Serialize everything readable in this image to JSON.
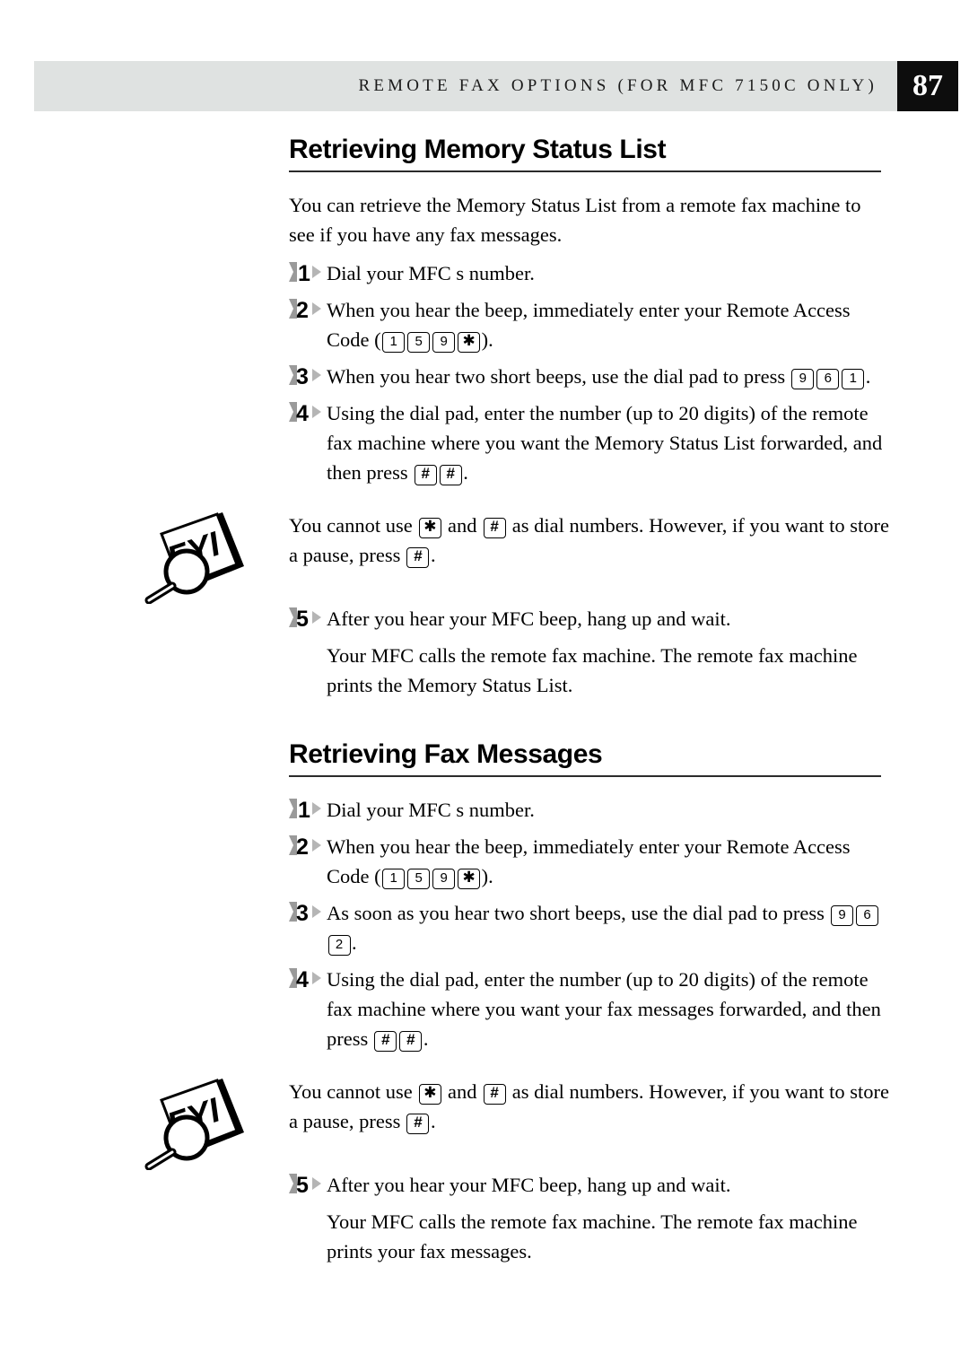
{
  "header": {
    "running_title": "REMOTE FAX OPTIONS (FOR MFC 7150C ONLY)",
    "page_number": "87",
    "band_color": "#dfe2e1",
    "page_number_bg": "#0d0d0d"
  },
  "sections": [
    {
      "heading": "Retrieving Memory Status List",
      "intro": "You can retrieve the Memory Status List from a remote fax machine to see if you have any fax messages.",
      "steps": [
        {
          "number": "1",
          "text": "Dial your MFC s number."
        },
        {
          "number": "2",
          "text_before": "When you hear the beep, immediately enter your Remote Access Code (",
          "keys": [
            "1",
            "5",
            "9",
            "✱"
          ],
          "text_after": ")."
        },
        {
          "number": "3",
          "text_before": "When you hear two short beeps, use the dial pad to press ",
          "keys": [
            "9",
            "6",
            "1"
          ],
          "text_after": "."
        },
        {
          "number": "4",
          "text_before": "Using the dial pad, enter the number (up to 20 digits) of the remote fax machine where you want the Memory Status List forwarded, and then press ",
          "keys": [
            "#",
            "#"
          ],
          "text_after": "."
        },
        {
          "number": "5",
          "text": "After you hear your MFC beep, hang up and wait.",
          "continuation": "Your MFC calls the remote fax machine. The remote fax machine prints the Memory Status List."
        }
      ],
      "note": {
        "icon": "fyi-icon",
        "text_before": "You cannot use ",
        "key_star": "✱",
        "text_mid1": " and ",
        "key_hash": "#",
        "text_mid2": " as dial numbers. However, if you want to store a pause, press ",
        "key_hash2": "#",
        "text_after": "."
      }
    },
    {
      "heading": "Retrieving Fax Messages",
      "steps": [
        {
          "number": "1",
          "text": "Dial your MFC s number."
        },
        {
          "number": "2",
          "text_before": "When you hear the beep, immediately enter your Remote Access Code (",
          "keys": [
            "1",
            "5",
            "9",
            "✱"
          ],
          "text_after": ")."
        },
        {
          "number": "3",
          "text_before": "As soon as you hear two short beeps, use the dial pad to press ",
          "keys": [
            "9",
            "6",
            "2"
          ],
          "text_after": "."
        },
        {
          "number": "4",
          "text_before": "Using the dial pad, enter the number (up to 20 digits) of the remote fax machine where you want your fax messages forwarded, and then press ",
          "keys": [
            "#",
            "#"
          ],
          "text_after": "."
        },
        {
          "number": "5",
          "text": "After you hear your MFC beep, hang up and wait.",
          "continuation": "Your MFC calls the remote fax machine. The remote fax machine prints your fax messages."
        }
      ],
      "note": {
        "icon": "fyi-icon",
        "text_before": "You cannot use ",
        "key_star": "✱",
        "text_mid1": " and ",
        "key_hash": "#",
        "text_mid2": " as dial numbers.  However, if you want to store a pause, press ",
        "key_hash2": "#",
        "text_after": "."
      }
    }
  ]
}
